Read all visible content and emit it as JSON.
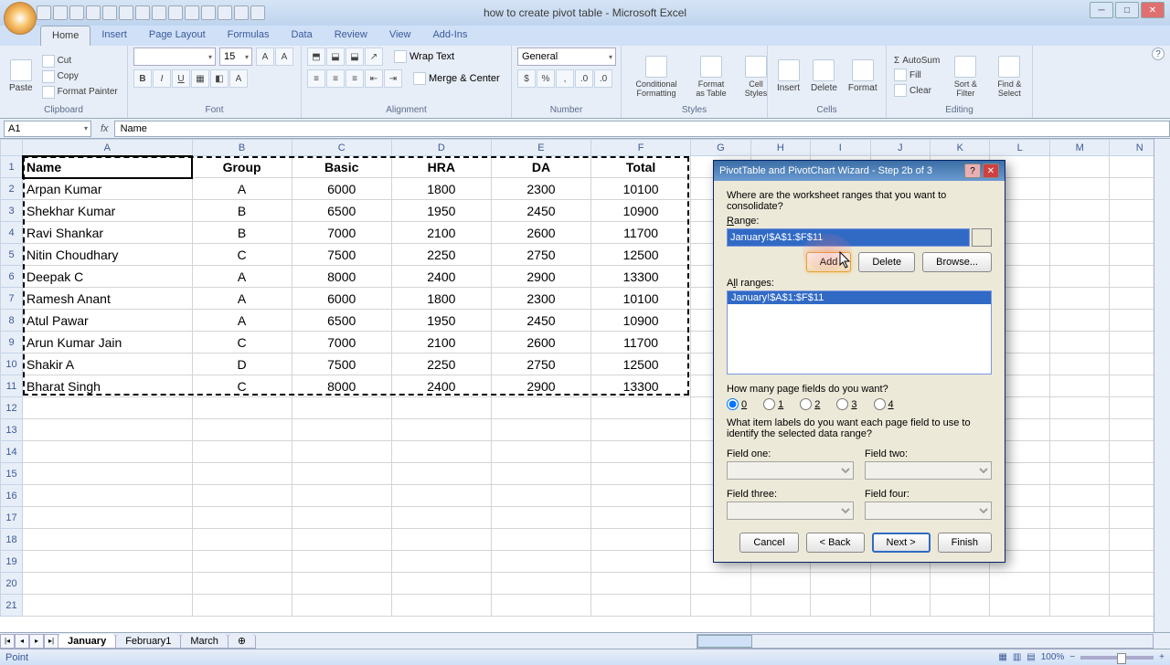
{
  "titlebar": {
    "title": "how to create pivot table - Microsoft Excel"
  },
  "tabs": [
    "Home",
    "Insert",
    "Page Layout",
    "Formulas",
    "Data",
    "Review",
    "View",
    "Add-Ins"
  ],
  "active_tab": 0,
  "ribbon": {
    "clipboard": {
      "label": "Clipboard",
      "paste": "Paste",
      "cut": "Cut",
      "copy": "Copy",
      "fmtpainter": "Format Painter"
    },
    "font": {
      "label": "Font",
      "size": "15"
    },
    "alignment": {
      "label": "Alignment",
      "wrap": "Wrap Text",
      "merge": "Merge & Center"
    },
    "number": {
      "label": "Number",
      "format": "General"
    },
    "styles": {
      "label": "Styles",
      "cond": "Conditional Formatting",
      "fat": "Format as Table",
      "cell": "Cell Styles"
    },
    "cells": {
      "label": "Cells",
      "insert": "Insert",
      "delete": "Delete",
      "format": "Format"
    },
    "editing": {
      "label": "Editing",
      "sum": "AutoSum",
      "fill": "Fill",
      "clear": "Clear",
      "sort": "Sort & Filter",
      "find": "Find & Select"
    }
  },
  "namebox": "A1",
  "formula": "Name",
  "columns": [
    "A",
    "B",
    "C",
    "D",
    "E",
    "F",
    "G",
    "H",
    "I",
    "J",
    "K",
    "L",
    "M",
    "N"
  ],
  "headers": [
    "Name",
    "Group",
    "Basic",
    "HRA",
    "DA",
    "Total"
  ],
  "rows": [
    [
      "Arpan Kumar",
      "A",
      "6000",
      "1800",
      "2300",
      "10100"
    ],
    [
      "Shekhar Kumar",
      "B",
      "6500",
      "1950",
      "2450",
      "10900"
    ],
    [
      "Ravi Shankar",
      "B",
      "7000",
      "2100",
      "2600",
      "11700"
    ],
    [
      "Nitin Choudhary",
      "C",
      "7500",
      "2250",
      "2750",
      "12500"
    ],
    [
      "Deepak C",
      "A",
      "8000",
      "2400",
      "2900",
      "13300"
    ],
    [
      "Ramesh Anant",
      "A",
      "6000",
      "1800",
      "2300",
      "10100"
    ],
    [
      "Atul Pawar",
      "A",
      "6500",
      "1950",
      "2450",
      "10900"
    ],
    [
      "Arun Kumar Jain",
      "C",
      "7000",
      "2100",
      "2600",
      "11700"
    ],
    [
      "Shakir A",
      "D",
      "7500",
      "2250",
      "2750",
      "12500"
    ],
    [
      "Bharat Singh",
      "C",
      "8000",
      "2400",
      "2900",
      "13300"
    ]
  ],
  "sheets": [
    "January",
    "February1",
    "March"
  ],
  "active_sheet": 0,
  "status": "Point",
  "zoom": "100%",
  "dialog": {
    "title": "PivotTable and PivotChart Wizard - Step 2b of 3",
    "q1": "Where are the worksheet ranges that you want to consolidate?",
    "range_label": "Range:",
    "range_value": "January!$A$1:$F$11",
    "add": "Add",
    "delete": "Delete",
    "browse": "Browse...",
    "allranges_label": "All ranges:",
    "allranges_item": "January!$A$1:$F$11",
    "q2": "How many page fields do you want?",
    "radios": [
      "0",
      "1",
      "2",
      "3",
      "4"
    ],
    "radio_selected": 0,
    "q3": "What item labels do you want each page field to use to identify the selected data range?",
    "field_labels": [
      "Field one:",
      "Field two:",
      "Field three:",
      "Field four:"
    ],
    "cancel": "Cancel",
    "back": "< Back",
    "next": "Next >",
    "finish": "Finish"
  }
}
